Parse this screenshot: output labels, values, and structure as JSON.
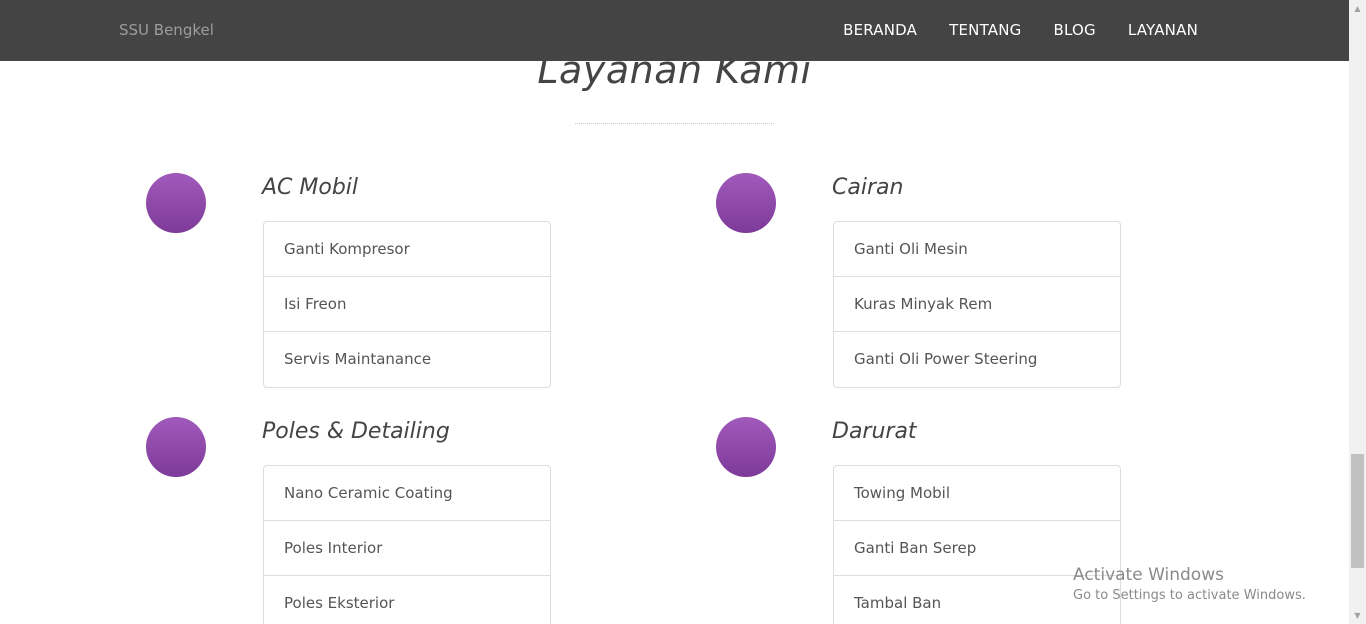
{
  "navbar": {
    "brand": "SSU Bengkel",
    "links": [
      "BERANDA",
      "TENTANG",
      "BLOG",
      "LAYANAN"
    ]
  },
  "section": {
    "title": "Layanan Kami"
  },
  "services": [
    {
      "title": "AC Mobil",
      "icon": "service-circle-icon",
      "items": [
        "Ganti Kompresor",
        "Isi Freon",
        "Servis Maintanance"
      ]
    },
    {
      "title": "Cairan",
      "icon": "service-circle-icon",
      "items": [
        "Ganti Oli Mesin",
        "Kuras Minyak Rem",
        "Ganti Oli Power Steering"
      ]
    },
    {
      "title": "Poles & Detailing",
      "icon": "service-circle-icon",
      "items": [
        "Nano Ceramic Coating",
        "Poles Interior",
        "Poles Eksterior"
      ]
    },
    {
      "title": "Darurat",
      "icon": "service-circle-icon",
      "items": [
        "Towing Mobil",
        "Ganti Ban Serep",
        "Tambal Ban"
      ]
    }
  ],
  "watermark": {
    "title": "Activate Windows",
    "subtitle": "Go to Settings to activate Windows."
  },
  "colors": {
    "navbar_bg": "#444444",
    "accent_purple": "#8e44ad"
  }
}
